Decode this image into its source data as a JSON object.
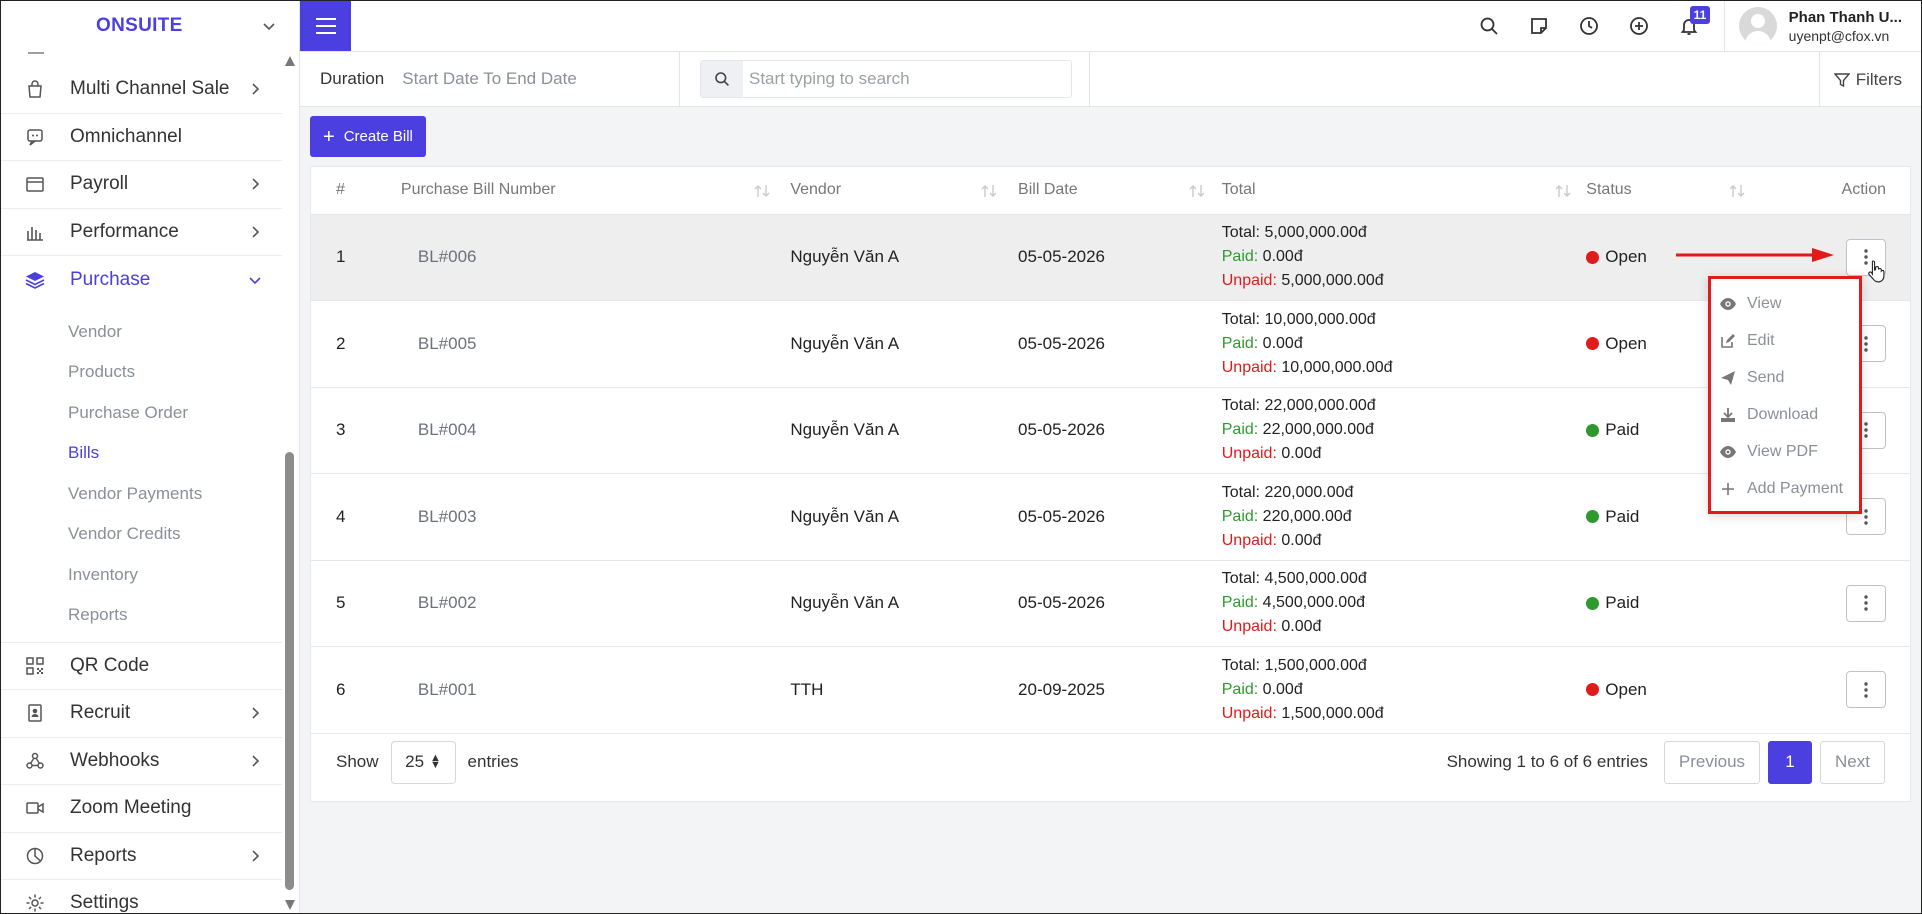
{
  "app": {
    "brand": "ONSUITE"
  },
  "sidebar": {
    "items": [
      {
        "label": "Multi Channel Sale",
        "icon": "shopping-bag-icon",
        "has_arrow": true
      },
      {
        "label": "Omnichannel",
        "icon": "chat-bubble-icon",
        "has_arrow": false
      },
      {
        "label": "Payroll",
        "icon": "wallet-icon",
        "has_arrow": true
      },
      {
        "label": "Performance",
        "icon": "bar-chart-icon",
        "has_arrow": true
      },
      {
        "label": "Purchase",
        "icon": "layers-icon",
        "has_arrow": true,
        "expanded": true
      }
    ],
    "purchase_sub": [
      "Vendor",
      "Products",
      "Purchase Order",
      "Bills",
      "Vendor Payments",
      "Vendor Credits",
      "Inventory",
      "Reports"
    ],
    "active_sub": "Bills",
    "items_after": [
      {
        "label": "QR Code",
        "icon": "qr-code-icon",
        "has_arrow": false
      },
      {
        "label": "Recruit",
        "icon": "id-badge-icon",
        "has_arrow": true
      },
      {
        "label": "Webhooks",
        "icon": "webhook-icon",
        "has_arrow": true
      },
      {
        "label": "Zoom Meeting",
        "icon": "video-camera-icon",
        "has_arrow": false
      },
      {
        "label": "Reports",
        "icon": "pie-chart-icon",
        "has_arrow": true
      },
      {
        "label": "Settings",
        "icon": "gear-icon",
        "has_arrow": false
      }
    ]
  },
  "topbar": {
    "notification_count": "11",
    "user_name": "Phan Thanh U...",
    "user_email": "uyenpt@cfox.vn"
  },
  "filterbar": {
    "duration_label": "Duration",
    "duration_value": "Start Date To End Date",
    "search_placeholder": "Start typing to search",
    "filters_label": "Filters"
  },
  "create_button": "Create Bill",
  "table": {
    "headers": [
      "#",
      "Purchase Bill Number",
      "Vendor",
      "Bill Date",
      "Total",
      "Status",
      "Action"
    ],
    "total_prefix": "Total:",
    "paid_prefix": "Paid:",
    "unpaid_prefix": "Unpaid:",
    "rows": [
      {
        "num": "1",
        "bill": "BL#006",
        "vendor": "Nguyễn Văn A",
        "date": "05-05-2026",
        "total": "5,000,000.00đ",
        "paid": "0.00đ",
        "unpaid": "5,000,000.00đ",
        "status": "Open"
      },
      {
        "num": "2",
        "bill": "BL#005",
        "vendor": "Nguyễn Văn A",
        "date": "05-05-2026",
        "total": "10,000,000.00đ",
        "paid": "0.00đ",
        "unpaid": "10,000,000.00đ",
        "status": "Open"
      },
      {
        "num": "3",
        "bill": "BL#004",
        "vendor": "Nguyễn Văn A",
        "date": "05-05-2026",
        "total": "22,000,000.00đ",
        "paid": "22,000,000.00đ",
        "unpaid": "0.00đ",
        "status": "Paid"
      },
      {
        "num": "4",
        "bill": "BL#003",
        "vendor": "Nguyễn Văn A",
        "date": "05-05-2026",
        "total": "220,000.00đ",
        "paid": "220,000.00đ",
        "unpaid": "0.00đ",
        "status": "Paid"
      },
      {
        "num": "5",
        "bill": "BL#002",
        "vendor": "Nguyễn Văn A",
        "date": "05-05-2026",
        "total": "4,500,000.00đ",
        "paid": "4,500,000.00đ",
        "unpaid": "0.00đ",
        "status": "Paid"
      },
      {
        "num": "6",
        "bill": "BL#001",
        "vendor": "TTH",
        "date": "20-09-2025",
        "total": "1,500,000.00đ",
        "paid": "0.00đ",
        "unpaid": "1,500,000.00đ",
        "status": "Open"
      }
    ]
  },
  "pagination": {
    "show_label": "Show",
    "page_size": "25",
    "entries_label": "entries",
    "info": "Showing 1 to 6 of 6 entries",
    "previous": "Previous",
    "current_page": "1",
    "next": "Next"
  },
  "action_menu": {
    "items": [
      {
        "label": "View",
        "icon": "eye-icon"
      },
      {
        "label": "Edit",
        "icon": "edit-icon"
      },
      {
        "label": "Send",
        "icon": "send-icon"
      },
      {
        "label": "Download",
        "icon": "download-icon"
      },
      {
        "label": "View PDF",
        "icon": "eye-icon"
      },
      {
        "label": "Add Payment",
        "icon": "plus-icon"
      }
    ]
  },
  "colors": {
    "accent": "#4b3fe0",
    "open": "#e01b1b",
    "paid": "#2e9a2e",
    "highlight_box": "#e31a1a"
  }
}
